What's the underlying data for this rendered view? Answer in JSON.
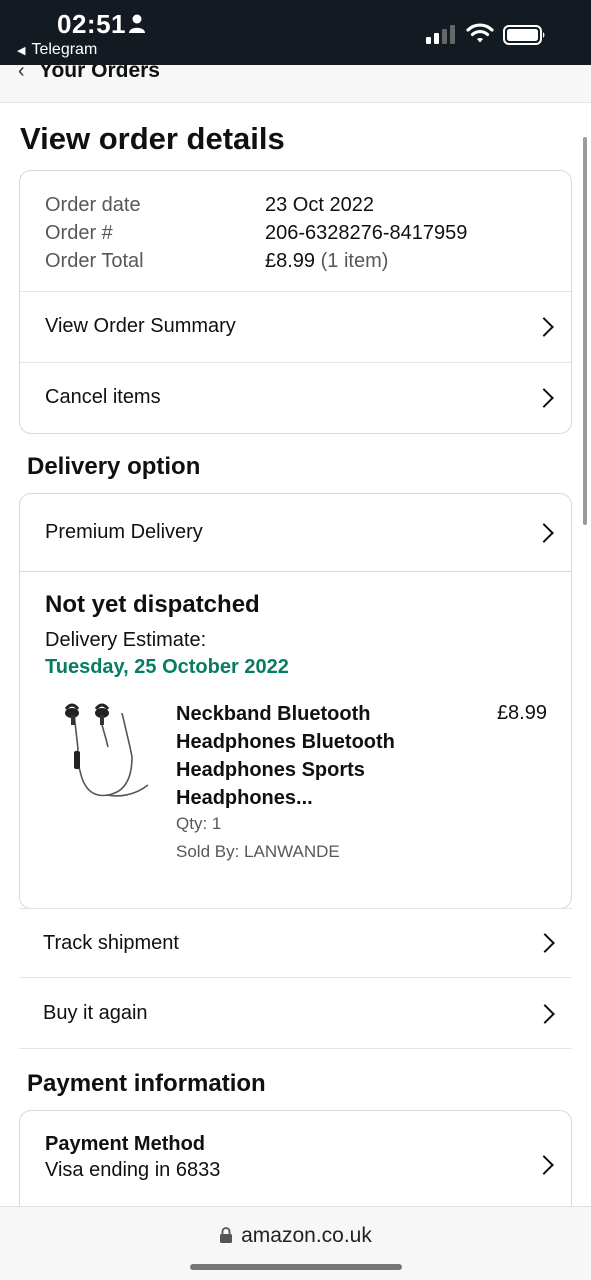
{
  "status_bar": {
    "time": "02:51",
    "back_app": "Telegram"
  },
  "nav": {
    "back_label": "Your Orders"
  },
  "page_title": "View order details",
  "order_info": {
    "rows": [
      {
        "label": "Order date",
        "value": "23 Oct 2022",
        "extra": ""
      },
      {
        "label": "Order #",
        "value": "206-6328276-8417959",
        "extra": ""
      },
      {
        "label": "Order Total",
        "value": "£8.99",
        "extra": "(1 item)"
      }
    ],
    "view_summary": "View Order Summary",
    "cancel_items": "Cancel items"
  },
  "delivery": {
    "section_title": "Delivery option",
    "option": "Premium Delivery",
    "status": "Not yet dispatched",
    "estimate_label": "Delivery Estimate:",
    "estimate_date": "Tuesday, 25 October 2022",
    "estimate_color": "#067d62",
    "product": {
      "title": "Neckband Bluetooth Headphones Bluetooth Headphones Sports Headphones...",
      "price": "£8.99",
      "qty": "Qty: 1",
      "sold_by": "Sold By: LANWANDE"
    }
  },
  "actions": {
    "track": "Track shipment",
    "buy_again": "Buy it again"
  },
  "payment": {
    "section_title": "Payment information",
    "method_label": "Payment Method",
    "method_value": "Visa ending in 6833"
  },
  "browser": {
    "url": "amazon.co.uk"
  }
}
